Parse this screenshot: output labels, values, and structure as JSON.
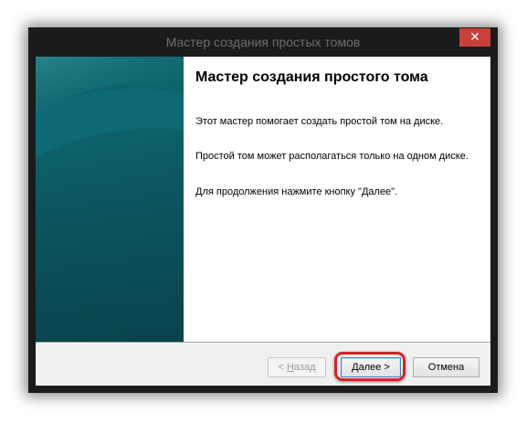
{
  "window": {
    "title": "Мастер создания простых томов",
    "close_symbol": "✕"
  },
  "content": {
    "heading": "Мастер создания простого тома",
    "paragraphs": [
      "Этот мастер помогает создать простой том на диске.",
      "Простой том может располагаться только на одном диске.",
      "Для продолжения нажмите кнопку \"Далее\"."
    ]
  },
  "buttons": {
    "back": {
      "prefix": "< ",
      "mnemonic": "Н",
      "rest": "азад",
      "enabled": false
    },
    "next": {
      "mnemonic": "Д",
      "rest": "алее >",
      "focused": true
    },
    "cancel": {
      "label": "Отмена"
    }
  },
  "annotation": {
    "highlight_color": "#d4232a",
    "target": "next-button"
  },
  "colors": {
    "titlebar": "#1b1b1b",
    "close_button": "#c7403a",
    "sidebar": "#0d5d66"
  },
  "icons": {
    "close": "close-icon"
  }
}
